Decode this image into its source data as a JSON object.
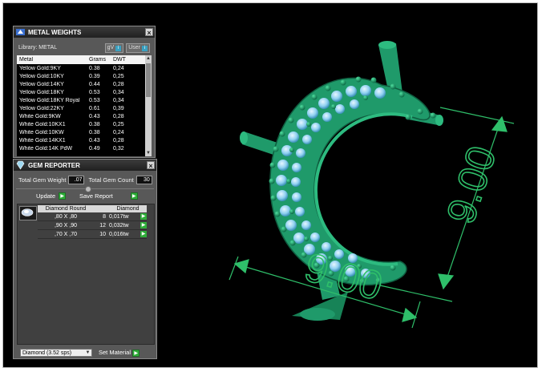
{
  "metal_panel": {
    "title": "METAL WEIGHTS",
    "library_label": "Library: METAL",
    "unit_options": [
      "gV",
      "User"
    ],
    "columns": [
      "Metal",
      "Grams",
      "DWT"
    ],
    "rows": [
      [
        "Yellow Gold:9KY",
        "0.38",
        "0,24"
      ],
      [
        "Yellow Gold:10KY",
        "0.39",
        "0,25"
      ],
      [
        "Yellow Gold:14KY",
        "0.44",
        "0,28"
      ],
      [
        "Yellow Gold:18KY",
        "0.53",
        "0,34"
      ],
      [
        "Yellow Gold:18KY Royal",
        "0.53",
        "0,34"
      ],
      [
        "Yellow Gold:22KY",
        "0.61",
        "0,39"
      ],
      [
        "White Gold:9KW",
        "0.43",
        "0,28"
      ],
      [
        "White Gold:10KX1",
        "0.38",
        "0,25"
      ],
      [
        "White Gold:10KW",
        "0.38",
        "0,24"
      ],
      [
        "White Gold:14KX1",
        "0.43",
        "0,28"
      ],
      [
        "White Gold:14K PdW",
        "0.49",
        "0,32"
      ]
    ]
  },
  "gem_panel": {
    "title": "GEM REPORTER",
    "total_weight_label": "Total Gem Weight",
    "total_weight_value": ".07",
    "total_count_label": "Total Gem Count",
    "total_count_value": "30",
    "update_label": "Update",
    "save_report_label": "Save Report",
    "columns": [
      "Diamond Round",
      "",
      "Diamond"
    ],
    "rows": [
      [
        ",80 X ,80",
        "8",
        "0,017tw"
      ],
      [
        ",90 X ,90",
        "12",
        "0,032tw"
      ],
      [
        ",70 X ,70",
        "10",
        "0,016tw"
      ]
    ],
    "material_select": "Diamond    (3.52 sps)",
    "set_material_label": "Set Material"
  },
  "viewport": {
    "dimension_vertical": "9.00",
    "dimension_horizontal": "9.00",
    "colors": {
      "background": "#000000",
      "metal": "#1f9a6a",
      "gem": "#8fd0f0",
      "dimension": "#2fbf6a"
    }
  }
}
